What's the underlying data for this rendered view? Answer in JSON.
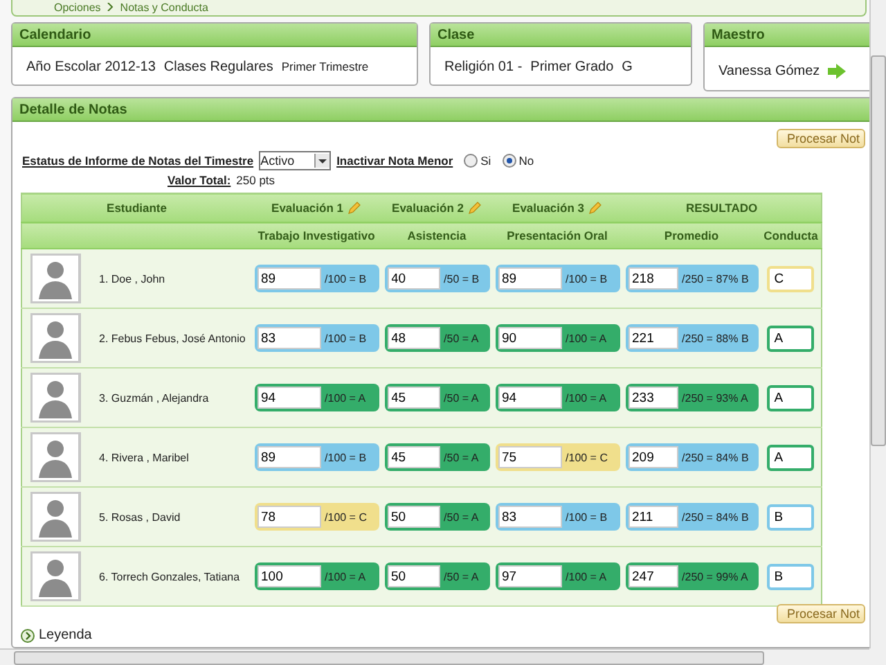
{
  "breadcrumb": [
    "Opciones",
    "Notas y Conducta"
  ],
  "panels": [
    {
      "title": "Calendario",
      "parts": [
        "Año Escolar 2012-13",
        "Clases Regulares",
        "Primer Trimestre"
      ]
    },
    {
      "title": "Clase",
      "parts": [
        "Religión 01 -",
        "Primer Grado",
        "G"
      ]
    },
    {
      "title": "Maestro",
      "parts": [
        "Vanessa Gómez"
      ]
    }
  ],
  "detail": {
    "title": "Detalle de Notas",
    "process_button": "Procesar Not",
    "status_label": "Estatus de Informe de Notas del Timestre",
    "status_value": "Activo",
    "inactivate_label": "Inactivar Nota Menor",
    "radios": [
      {
        "label": "Si",
        "selected": false
      },
      {
        "label": "No",
        "selected": true
      }
    ],
    "total_label": "Valor Total:",
    "total_value": "250 pts",
    "header": {
      "student": "Estudiante",
      "evaluations": [
        "Evaluación 1",
        "Evaluación 2",
        "Evaluación 3"
      ],
      "result": "RESULTADO",
      "subheaders": [
        "Trabajo Investigativo",
        "Asistencia",
        "Presentación Oral",
        "Promedio",
        "Conducta"
      ]
    },
    "students": [
      {
        "name": "1. Doe , John",
        "scores": [
          {
            "value": "89",
            "suffix": "/100 = B",
            "color": "#7ec8e8"
          },
          {
            "value": "40",
            "suffix": "/50 = B",
            "color": "#7ec8e8"
          },
          {
            "value": "89",
            "suffix": "/100 = B",
            "color": "#7ec8e8"
          }
        ],
        "average": {
          "value": "218",
          "suffix": "/250 = 87% B",
          "color": "#7ec8e8"
        },
        "conduct": {
          "value": "C",
          "color": "#f0df8c"
        }
      },
      {
        "name": "2. Febus Febus, José Antonio",
        "scores": [
          {
            "value": "83",
            "suffix": "/100 = B",
            "color": "#7ec8e8"
          },
          {
            "value": "48",
            "suffix": "/50 = A",
            "color": "#34ad6a"
          },
          {
            "value": "90",
            "suffix": "/100 = A",
            "color": "#34ad6a"
          }
        ],
        "average": {
          "value": "221",
          "suffix": "/250 = 88% B",
          "color": "#7ec8e8"
        },
        "conduct": {
          "value": "A",
          "color": "#34ad6a"
        }
      },
      {
        "name": "3. Guzmán , Alejandra",
        "scores": [
          {
            "value": "94",
            "suffix": "/100 = A",
            "color": "#34ad6a"
          },
          {
            "value": "45",
            "suffix": "/50 = A",
            "color": "#34ad6a"
          },
          {
            "value": "94",
            "suffix": "/100 = A",
            "color": "#34ad6a"
          }
        ],
        "average": {
          "value": "233",
          "suffix": "/250 = 93% A",
          "color": "#34ad6a"
        },
        "conduct": {
          "value": "A",
          "color": "#34ad6a"
        }
      },
      {
        "name": "4. Rivera , Maribel",
        "scores": [
          {
            "value": "89",
            "suffix": "/100 = B",
            "color": "#7ec8e8"
          },
          {
            "value": "45",
            "suffix": "/50 = A",
            "color": "#34ad6a"
          },
          {
            "value": "75",
            "suffix": "/100 = C",
            "color": "#f0df8c"
          }
        ],
        "average": {
          "value": "209",
          "suffix": "/250 = 84% B",
          "color": "#7ec8e8"
        },
        "conduct": {
          "value": "A",
          "color": "#34ad6a"
        }
      },
      {
        "name": "5. Rosas , David",
        "scores": [
          {
            "value": "78",
            "suffix": "/100 = C",
            "color": "#f0df8c"
          },
          {
            "value": "50",
            "suffix": "/50 = A",
            "color": "#34ad6a"
          },
          {
            "value": "83",
            "suffix": "/100 = B",
            "color": "#7ec8e8"
          }
        ],
        "average": {
          "value": "211",
          "suffix": "/250 = 84% B",
          "color": "#7ec8e8"
        },
        "conduct": {
          "value": "B",
          "color": "#7ec8e8"
        }
      },
      {
        "name": "6. Torrech Gonzales, Tatiana",
        "scores": [
          {
            "value": "100",
            "suffix": "/100 = A",
            "color": "#34ad6a"
          },
          {
            "value": "50",
            "suffix": "/50 = A",
            "color": "#34ad6a"
          },
          {
            "value": "97",
            "suffix": "/100 = A",
            "color": "#34ad6a"
          }
        ],
        "average": {
          "value": "247",
          "suffix": "/250 = 99% A",
          "color": "#34ad6a"
        },
        "conduct": {
          "value": "B",
          "color": "#7ec8e8"
        }
      }
    ],
    "bottom_button": "Procesar Not",
    "legend": "Leyenda"
  }
}
